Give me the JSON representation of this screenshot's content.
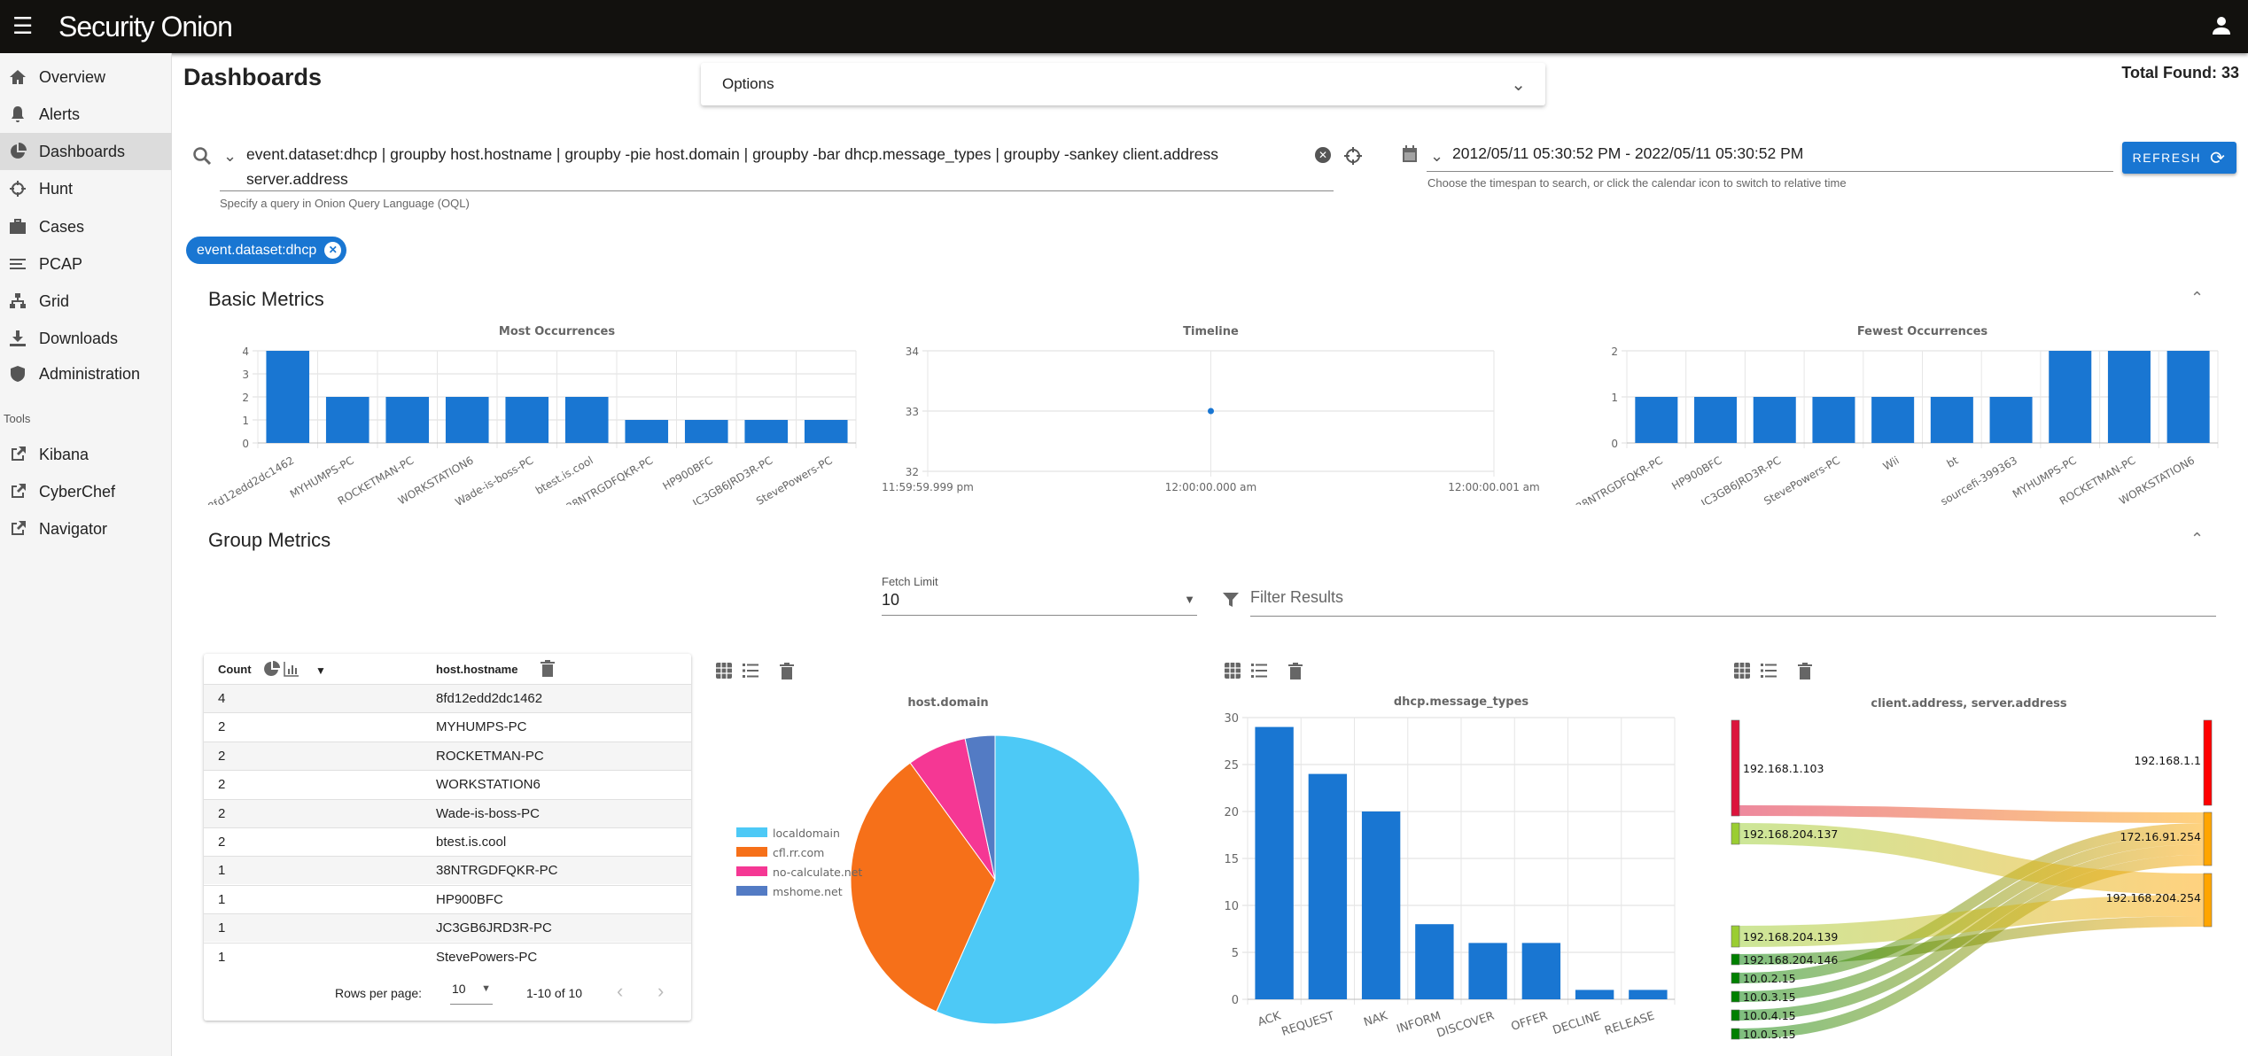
{
  "app": {
    "brand": "Security Onion"
  },
  "sidebar": {
    "items": [
      {
        "label": "Overview",
        "icon": "home-icon"
      },
      {
        "label": "Alerts",
        "icon": "bell-icon"
      },
      {
        "label": "Dashboards",
        "icon": "pie-icon",
        "active": true
      },
      {
        "label": "Hunt",
        "icon": "crosshair-icon"
      },
      {
        "label": "Cases",
        "icon": "briefcase-icon"
      },
      {
        "label": "PCAP",
        "icon": "lines-icon"
      },
      {
        "label": "Grid",
        "icon": "grid-icon"
      },
      {
        "label": "Downloads",
        "icon": "download-icon"
      },
      {
        "label": "Administration",
        "icon": "shield-icon"
      }
    ],
    "tools_label": "Tools",
    "tools": [
      {
        "label": "Kibana"
      },
      {
        "label": "CyberChef"
      },
      {
        "label": "Navigator"
      }
    ]
  },
  "page": {
    "title": "Dashboards",
    "options_label": "Options",
    "total_found": "Total Found: 33"
  },
  "query": {
    "value": "event.dataset:dhcp | groupby host.hostname | groupby -pie host.domain | groupby -bar dhcp.message_types | groupby -sankey client.address server.address",
    "hint": "Specify a query in Onion Query Language (OQL)"
  },
  "daterange": {
    "value": "2012/05/11 05:30:52 PM - 2022/05/11 05:30:52 PM",
    "hint": "Choose the timespan to search, or click the calendar icon to switch to relative time"
  },
  "refresh_label": "REFRESH",
  "filter_chip": "event.dataset:dhcp",
  "basic_metrics": "Basic Metrics",
  "group_metrics": "Group Metrics",
  "fetch_limit": {
    "label": "Fetch Limit",
    "value": "10"
  },
  "filter_results": {
    "placeholder": "Filter Results"
  },
  "table": {
    "headers": [
      "Count",
      "host.hostname"
    ],
    "rows": [
      [
        "4",
        "8fd12edd2dc1462"
      ],
      [
        "2",
        "MYHUMPS-PC"
      ],
      [
        "2",
        "ROCKETMAN-PC"
      ],
      [
        "2",
        "WORKSTATION6"
      ],
      [
        "2",
        "Wade-is-boss-PC"
      ],
      [
        "2",
        "btest.is.cool"
      ],
      [
        "1",
        "38NTRGDFQKR-PC"
      ],
      [
        "1",
        "HP900BFC"
      ],
      [
        "1",
        "JC3GB6JRD3R-PC"
      ],
      [
        "1",
        "StevePowers-PC"
      ]
    ],
    "rows_per_page_label": "Rows per page:",
    "rows_per_page": "10",
    "range": "1-10 of 10"
  },
  "colors": {
    "accent": "#1976d2",
    "bar": "#1976d2",
    "topbar": "#12110e"
  },
  "chart_data": [
    {
      "type": "bar",
      "title": "Most Occurrences",
      "categories": [
        "8fd12edd2dc1462",
        "MYHUMPS-PC",
        "ROCKETMAN-PC",
        "WORKSTATION6",
        "Wade-is-boss-PC",
        "btest.is.cool",
        "38NTRGDFQKR-PC",
        "HP900BFC",
        "JC3GB6JRD3R-PC",
        "StevePowers-PC"
      ],
      "values": [
        4,
        2,
        2,
        2,
        2,
        2,
        1,
        1,
        1,
        1
      ],
      "ylim": [
        0,
        4
      ],
      "yticks": [
        "0",
        "1",
        "2",
        "3",
        "4"
      ],
      "grid": true
    },
    {
      "type": "scatter",
      "title": "Timeline",
      "x": [
        "12:00:00.000 am"
      ],
      "values": [
        33
      ],
      "ylim": [
        32,
        34
      ],
      "yticks": [
        "32",
        "33",
        "34"
      ],
      "xticks": [
        "11:59:59.999 pm",
        "12:00:00.000 am",
        "12:00:00.001 am"
      ],
      "grid": true
    },
    {
      "type": "bar",
      "title": "Fewest Occurrences",
      "categories": [
        "38NTRGDFQKR-PC",
        "HP900BFC",
        "JC3GB6JRD3R-PC",
        "StevePowers-PC",
        "Wii",
        "bt",
        "sourcefi-399363",
        "MYHUMPS-PC",
        "ROCKETMAN-PC",
        "WORKSTATION6"
      ],
      "values": [
        1,
        1,
        1,
        1,
        1,
        1,
        1,
        2,
        2,
        2
      ],
      "ylim": [
        0,
        2
      ],
      "yticks": [
        "0",
        "1",
        "2"
      ],
      "grid": true
    },
    {
      "type": "pie",
      "title": "host.domain",
      "categories": [
        "localdomain",
        "cfl.rr.com",
        "no-calculate.net",
        "mshome.net"
      ],
      "values": [
        17,
        10,
        2,
        1
      ],
      "colors": [
        "#4dc9f6",
        "#f67019",
        "#f53794",
        "#537bc4"
      ],
      "legend": "left"
    },
    {
      "type": "bar",
      "title": "dhcp.message_types",
      "categories": [
        "ACK",
        "REQUEST",
        "NAK",
        "INFORM",
        "DISCOVER",
        "OFFER",
        "DECLINE",
        "RELEASE"
      ],
      "values": [
        29,
        24,
        20,
        8,
        6,
        6,
        1,
        1
      ],
      "ylim": [
        0,
        30
      ],
      "yticks": [
        "0",
        "5",
        "10",
        "15",
        "20",
        "25",
        "30"
      ],
      "grid": true
    },
    {
      "type": "sankey",
      "title": "client.address, server.address",
      "nodes": [
        {
          "name": "192.168.1.103",
          "color": "#dc143c"
        },
        {
          "name": "192.168.204.137",
          "color": "#9acd32"
        },
        {
          "name": "192.168.204.139",
          "color": "#9acd32"
        },
        {
          "name": "192.168.204.146",
          "color": "#008000"
        },
        {
          "name": "10.0.2.15",
          "color": "#008000"
        },
        {
          "name": "10.0.3.15",
          "color": "#008000"
        },
        {
          "name": "10.0.4.15",
          "color": "#008000"
        },
        {
          "name": "10.0.5.15",
          "color": "#008000"
        },
        {
          "name": "192.168.1.1",
          "color": "#ff0000"
        },
        {
          "name": "172.16.91.254",
          "color": "#ffa500"
        },
        {
          "name": "192.168.204.254",
          "color": "#ffa500"
        }
      ],
      "links": [
        {
          "source": "192.168.1.103",
          "target": "192.168.1.1",
          "value": 16
        },
        {
          "source": "192.168.1.103",
          "target": "172.16.91.254",
          "value": 2
        },
        {
          "source": "10.0.2.15",
          "target": "172.16.91.254",
          "value": 2
        },
        {
          "source": "10.0.3.15",
          "target": "172.16.91.254",
          "value": 2
        },
        {
          "source": "10.0.4.15",
          "target": "172.16.91.254",
          "value": 2
        },
        {
          "source": "10.0.5.15",
          "target": "172.16.91.254",
          "value": 2
        },
        {
          "source": "192.168.204.137",
          "target": "192.168.204.254",
          "value": 4
        },
        {
          "source": "192.168.204.139",
          "target": "192.168.204.254",
          "value": 4
        },
        {
          "source": "192.168.204.146",
          "target": "192.168.204.254",
          "value": 2
        }
      ]
    }
  ]
}
